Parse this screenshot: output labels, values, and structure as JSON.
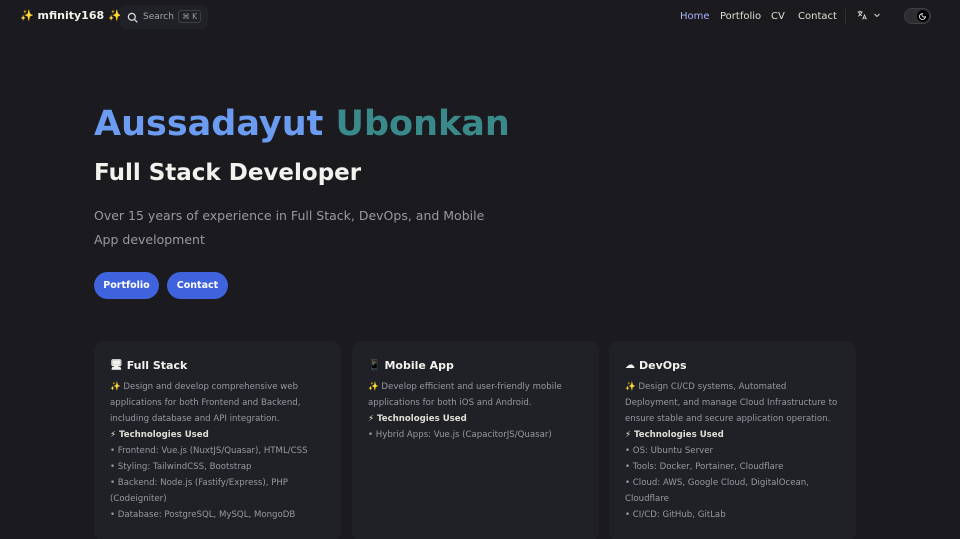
{
  "nav": {
    "logo": "✨ mfinity168 ✨",
    "search_label": "Search",
    "search_shortcut": "⌘ K",
    "links": [
      "Home",
      "Portfolio",
      "CV",
      "Contact"
    ],
    "active": "Home"
  },
  "hero": {
    "first_name": "Aussadayut",
    "last_name": "Ubonkan",
    "role": "Full Stack Developer",
    "description": "Over 15 years of experience in Full Stack, DevOps, and Mobile App development",
    "buttons": [
      "Portfolio",
      "Contact"
    ]
  },
  "cards": [
    {
      "icon": "🖥",
      "title": "Full Stack",
      "summary": "✨ Design and develop comprehensive web applications for both Frontend and Backend, including database and API integration.",
      "tech_heading": "⚡ Technologies Used",
      "items": [
        "• Frontend: Vue.js (NuxtJS/Quasar), HTML/CSS",
        "• Styling: TailwindCSS, Bootstrap",
        "• Backend: Node.js (Fastify/Express), PHP (Codeigniter)",
        "• Database: PostgreSQL, MySQL, MongoDB"
      ]
    },
    {
      "icon": "📱",
      "title": "Mobile App",
      "summary": "✨ Develop efficient and user-friendly mobile applications for both iOS and Android.",
      "tech_heading": "⚡ Technologies Used",
      "items": [
        "• Hybrid Apps: Vue.js (CapacitorJS/Quasar)"
      ]
    },
    {
      "icon": "☁",
      "title": "DevOps",
      "summary": "✨ Design CI/CD systems, Automated Deployment, and manage Cloud Infrastructure to ensure stable and secure application operation.",
      "tech_heading": "⚡ Technologies Used",
      "items": [
        "• OS: Ubuntu Server",
        "• Tools: Docker, Portainer, Cloudflare",
        "• Cloud: AWS, Google Cloud, DigitalOcean, Cloudflare",
        "• CI/CD: GitHub, GitLab"
      ]
    }
  ],
  "colors": {
    "background": "#1b1b1f",
    "card": "#202127",
    "accent": "#3e63dd",
    "active_link": "#a8b1ff",
    "name_first": "#6c9cf2",
    "name_last": "#3a8a8c"
  }
}
